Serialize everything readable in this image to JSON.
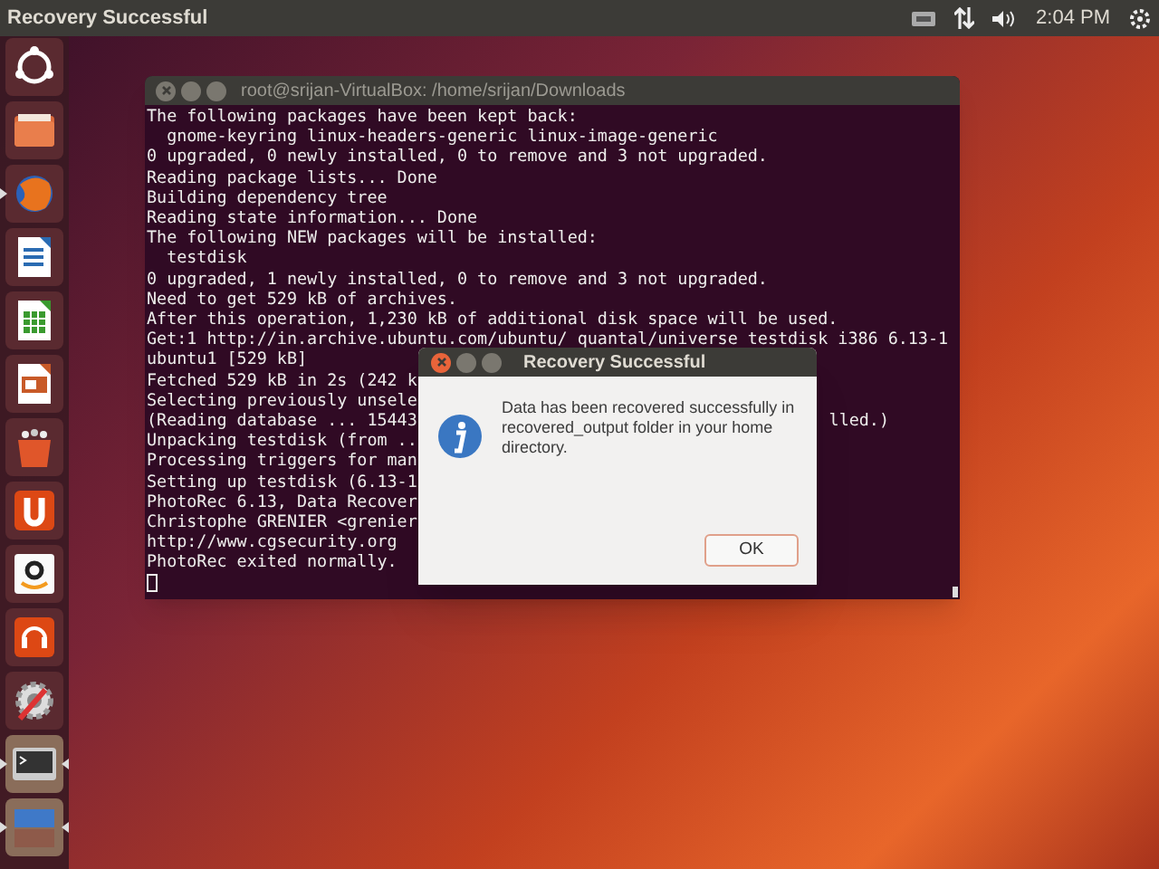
{
  "top_panel": {
    "title": "Recovery Successful",
    "clock": "2:04 PM"
  },
  "launcher": [
    {
      "kind": "dash",
      "running": false,
      "focused": false
    },
    {
      "kind": "files",
      "running": false,
      "focused": false
    },
    {
      "kind": "browser",
      "running": true,
      "focused": false
    },
    {
      "kind": "writer",
      "running": false,
      "focused": false
    },
    {
      "kind": "calc",
      "running": false,
      "focused": false
    },
    {
      "kind": "impress",
      "running": false,
      "focused": false
    },
    {
      "kind": "store",
      "running": false,
      "focused": false
    },
    {
      "kind": "cloud",
      "running": false,
      "focused": false
    },
    {
      "kind": "amazon",
      "running": false,
      "focused": false
    },
    {
      "kind": "music",
      "running": false,
      "focused": false
    },
    {
      "kind": "settings",
      "running": false,
      "focused": false
    },
    {
      "kind": "terminal",
      "running": true,
      "focused": true
    },
    {
      "kind": "workspaces",
      "running": true,
      "focused": true
    }
  ],
  "terminal": {
    "title": "root@srijan-VirtualBox: /home/srijan/Downloads",
    "lines": [
      {
        "text": "The following packages have been kept back:"
      },
      {
        "text": "  gnome-keyring linux-headers-generic linux-image-generic"
      },
      {
        "text": "0 upgraded, 0 newly installed, 0 to remove and 3 not upgraded."
      },
      {
        "text": "Reading package lists... Done"
      },
      {
        "text": "Building dependency tree"
      },
      {
        "text": "Reading state information... Done"
      },
      {
        "text": "The following NEW packages will be installed:"
      },
      {
        "text": "  testdisk"
      },
      {
        "text": "0 upgraded, 1 newly installed, 0 to remove and 3 not upgraded."
      },
      {
        "text": "Need to get 529 kB of archives."
      },
      {
        "text": "After this operation, 1,230 kB of additional disk space will be used."
      },
      {
        "text": "Get:1 http://in.archive.ubuntu.com/ubuntu/ quantal/universe testdisk i386 6.13-1"
      },
      {
        "text": "ubuntu1 [529 kB]"
      },
      {
        "text": "Fetched 529 kB in 2s (242 k"
      },
      {
        "text": "Selecting previously unsele"
      },
      {
        "text": "(Reading database ... 15443",
        "tail": "lled.)"
      },
      {
        "text": "Unpacking testdisk (from .."
      },
      {
        "text": "Processing triggers for man"
      },
      {
        "text": "Setting up testdisk (6.13-1"
      },
      {
        "text": "PhotoRec 6.13, Data Recover"
      },
      {
        "text": "Christophe GRENIER <grenier"
      },
      {
        "text": "http://www.cgsecurity.org"
      },
      {
        "text": "PhotoRec exited normally."
      }
    ]
  },
  "dialog": {
    "title": "Recovery Successful",
    "message": "Data has been recovered successfully in recovered_output folder in your home directory.",
    "button": "OK"
  }
}
